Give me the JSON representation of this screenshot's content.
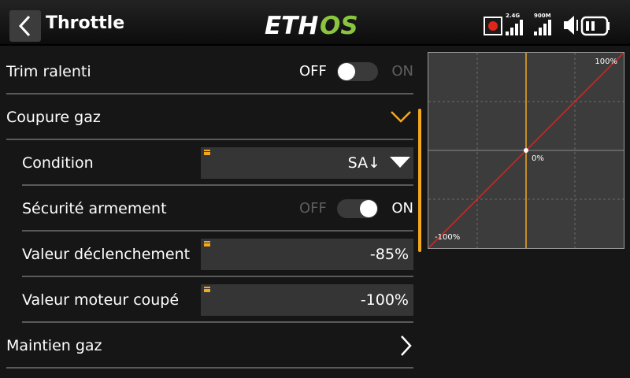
{
  "header": {
    "title": "Throttle",
    "logo": {
      "part1": "ETH",
      "part2": "OS",
      "color1": "#ffffff",
      "color2": "#8ac53f"
    },
    "status": {
      "record_icon": "record-icon",
      "signal1_label": "2.4G",
      "signal2_label": "900M",
      "volume_icon": "speaker-icon",
      "battery_icon": "battery-icon"
    }
  },
  "rows": [
    {
      "label": "Trim ralenti",
      "type": "toggle",
      "off_label": "OFF",
      "on_label": "ON",
      "state": false
    },
    {
      "label": "Coupure gaz",
      "type": "expand",
      "icon": "chevron-down-icon"
    },
    {
      "label": "Condition",
      "type": "select",
      "value": "SA↓",
      "icon": "caret-down-icon"
    },
    {
      "label": "Sécurité armement",
      "type": "toggle",
      "off_label": "OFF",
      "on_label": "ON",
      "state": true
    },
    {
      "label": "Valeur déclenchement",
      "type": "value",
      "value": "-85%"
    },
    {
      "label": "Valeur moteur coupé",
      "type": "value",
      "value": "-100%"
    },
    {
      "label": "Maintien gaz",
      "type": "link",
      "icon": "chevron-right-icon"
    }
  ],
  "graph": {
    "label_top_right": "100%",
    "label_center": "0%",
    "label_bottom_left": "-100%",
    "curve": [
      [
        -100,
        -100
      ],
      [
        100,
        100
      ]
    ],
    "input_position": 0,
    "line_color": "#e0251b",
    "cursor_color": "#f4a81d",
    "accent_color": "#f4a81d"
  }
}
